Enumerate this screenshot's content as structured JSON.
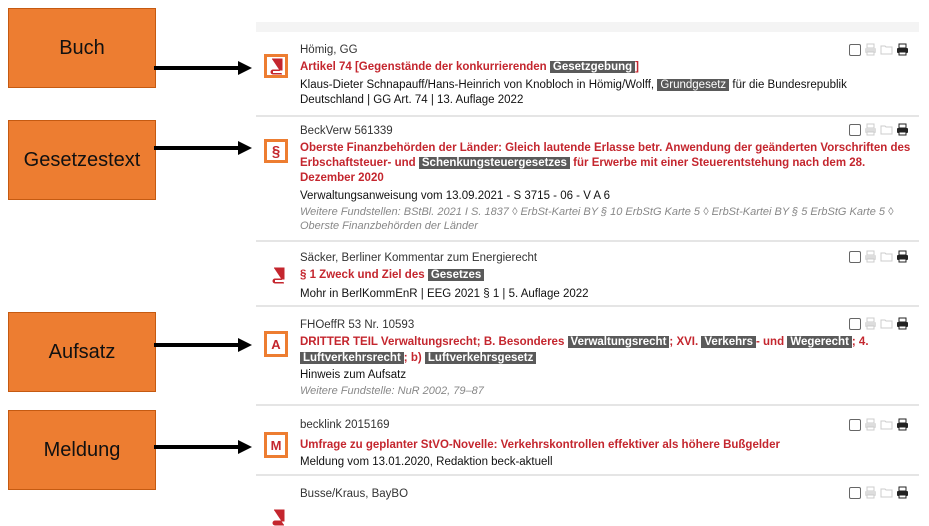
{
  "labels": {
    "buch": "Buch",
    "gesetzestext": "Gesetzestext",
    "aufsatz": "Aufsatz",
    "meldung": "Meldung"
  },
  "results": [
    {
      "type_icon": "book-icon",
      "source": "Hömig, GG",
      "title_a": "Artikel 74 [Gegenstände der konkurrierenden",
      "title_hl": "Gesetzgebung",
      "title_b": "]",
      "meta_a": "Klaus-Dieter Schnapauff/Hans-Heinrich von Knobloch in Hömig/Wolff,",
      "meta_hl": "Grundgesetz",
      "meta_b": "für die Bundesrepublik Deutschland | GG Art. 74 | 13. Auflage 2022"
    },
    {
      "type_icon": "paragraph-icon",
      "source": "BeckVerw 561339",
      "title_a": "Oberste Finanzbehörden der Länder: Gleich lautende Erlasse betr. Anwendung der geänderten Vorschriften des Erbschaftsteuer- und",
      "title_hl": "Schenkungsteuergesetzes",
      "title_b": "für Erwerbe mit einer Steuerentstehung nach dem 28. Dezember 2020",
      "meta": "Verwaltungsanweisung vom 13.09.2021 - S 3715 - 06 - V A 6",
      "meta_extra": "Weitere Fundstellen: BStBl. 2021 I S. 1837 ◊ ErbSt-Kartei BY § 10 ErbStG Karte 5 ◊ ErbSt-Kartei BY § 5 ErbStG Karte 5 ◊ Oberste Finanzbehörden der Länder"
    },
    {
      "type_icon": "book-icon",
      "source": "Säcker, Berliner Kommentar zum Energierecht",
      "title_a": "§ 1 Zweck und Ziel des",
      "title_hl": "Gesetzes",
      "meta": "Mohr in BerlKommEnR | EEG 2021 § 1 | 5. Auflage 2022"
    },
    {
      "type_icon": "article-icon",
      "source": "FHOeffR 53 Nr. 10593",
      "title_a": "DRITTER TEIL Verwaltungsrecht; B. Besonderes",
      "hl1": "Verwaltungsrecht",
      "t2": "; XVI.",
      "hl2": "Verkehrs",
      "t3": "- und",
      "hl3": "Wegerecht",
      "t4": "; 4.",
      "hl4": "Luftverkehrsrecht",
      "t5": "; b)",
      "hl5": "Luftverkehrsgesetz",
      "meta": "Hinweis zum Aufsatz",
      "meta_extra": "Weitere Fundstelle: NuR 2002, 79–87"
    },
    {
      "type_icon": "news-icon",
      "source": "becklink 2015169",
      "title_a": "Umfrage zu geplanter StVO-Novelle: Verkehrskontrollen effektiver als höhere Bußgelder",
      "meta": "Meldung vom 13.01.2020, Redaktion beck-aktuell"
    },
    {
      "type_icon": "book-icon",
      "source": "Busse/Kraus, BayBO"
    }
  ],
  "colors": {
    "accent": "#c4262e",
    "highlight": "#5a5a5a",
    "label_bg": "#ed7d31",
    "icon_frame": "#ed7d31"
  }
}
